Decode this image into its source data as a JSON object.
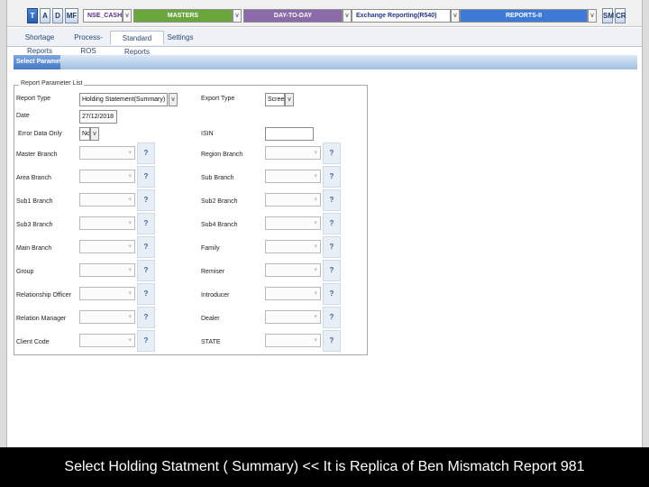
{
  "toolbar": {
    "mode_buttons": [
      "T",
      "A",
      "D",
      "MF"
    ],
    "segment_value": "NSE_CASH",
    "masters_label": "MASTERS",
    "daytoday_label": "DAY-TO-DAY",
    "exchange_label": "Exchange Reporting(R540)",
    "reports_label": "REPORTS-II",
    "right_buttons": [
      "SM",
      "CR"
    ],
    "dropdown_arrow": "v"
  },
  "tabs": [
    "Shortage Reports",
    "Process-ROS",
    "Standard Reports",
    "Settings"
  ],
  "active_tab": "Standard Reports",
  "section_title": "Select Parameters",
  "form": {
    "legend": "Report Parameter List",
    "report_type_label": "Report Type",
    "report_type_value": "Holding Statement(Summary)",
    "export_type_label": "Export Type",
    "export_type_value": "Screen",
    "date_label": "Date",
    "date_value": "27/12/2018",
    "error_only_label": "Error Data Only",
    "error_only_value": "No",
    "isin_label": "ISIN",
    "isin_value": "",
    "lookup_button_label": "?",
    "left_fields": [
      "Master Branch",
      "Area Branch",
      "Sub1 Branch",
      "Sub3 Branch",
      "Main Branch",
      "Group",
      "Relationship Officer",
      "Relation Manager",
      "Client Code"
    ],
    "right_fields": [
      "Region Branch",
      "Sub Branch",
      "Sub2 Branch",
      "Sub4 Branch",
      "Family",
      "Remiser",
      "Introducer",
      "Dealer",
      "STATE"
    ]
  },
  "caption": "Select Holding Statment ( Summary) << It is Replica of Ben Mismatch  Report 981"
}
